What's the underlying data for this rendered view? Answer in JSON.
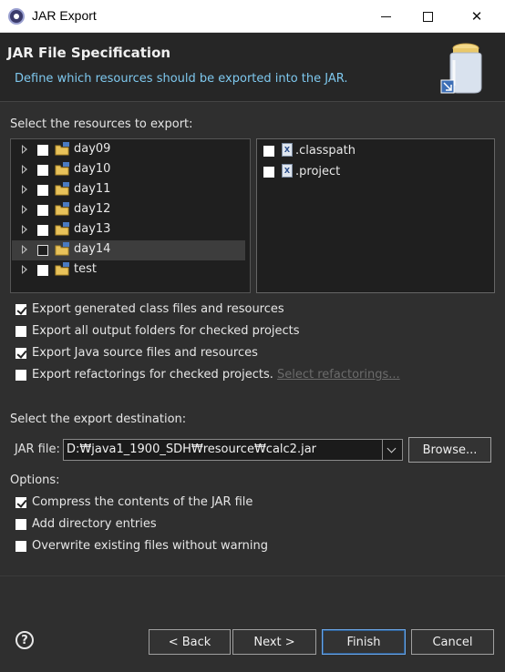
{
  "window": {
    "title": "JAR Export"
  },
  "header": {
    "title": "JAR File Specification",
    "description": "Define which resources should be exported into the JAR."
  },
  "resources": {
    "label": "Select the resources to export:",
    "tree": [
      {
        "label": "day09",
        "checked": false,
        "selected": false
      },
      {
        "label": "day10",
        "checked": false,
        "selected": false
      },
      {
        "label": "day11",
        "checked": false,
        "selected": false
      },
      {
        "label": "day12",
        "checked": false,
        "selected": false
      },
      {
        "label": "day13",
        "checked": false,
        "selected": false
      },
      {
        "label": "day14",
        "checked": false,
        "selected": true
      },
      {
        "label": "test",
        "checked": false,
        "selected": false
      }
    ],
    "files": [
      {
        "label": ".classpath",
        "checked": false
      },
      {
        "label": ".project",
        "checked": false
      }
    ]
  },
  "export_options": {
    "class_files": {
      "label": "Export generated class files and resources",
      "checked": true
    },
    "output_folders": {
      "label": "Export all output folders for checked projects",
      "checked": false
    },
    "java_source": {
      "label": "Export Java source files and resources",
      "checked": true
    },
    "refactorings": {
      "label": "Export refactorings for checked projects.",
      "checked": false
    },
    "select_refactorings_link": "Select refactorings..."
  },
  "destination": {
    "label": "Select the export destination:",
    "jar_label": "JAR file:",
    "jar_value": "D:₩java1_1900_SDH₩resource₩calc2.jar",
    "browse_label": "Browse..."
  },
  "options": {
    "label": "Options:",
    "compress": {
      "label": "Compress the contents of the JAR file",
      "checked": true
    },
    "directory_entries": {
      "label": "Add directory entries",
      "checked": false
    },
    "overwrite": {
      "label": "Overwrite existing files without warning",
      "checked": false
    }
  },
  "buttons": {
    "back": "< Back",
    "next": "Next >",
    "finish": "Finish",
    "cancel": "Cancel"
  },
  "colors": {
    "background": "#2f2f2f",
    "header_background": "#262626",
    "description": "#7ec8ee",
    "default_button_border": "#6aa6e8"
  }
}
